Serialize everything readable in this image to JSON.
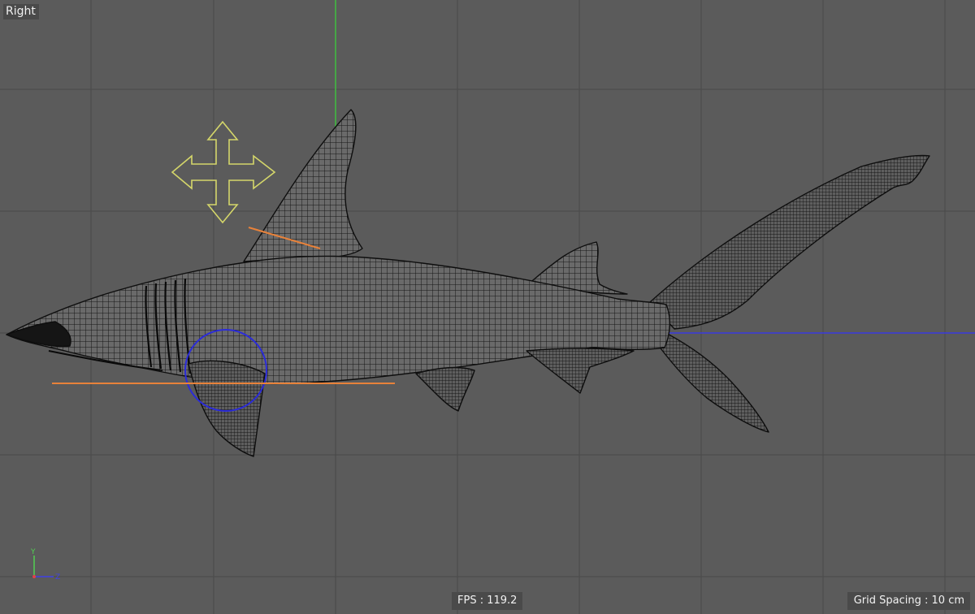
{
  "viewport": {
    "view_name": "Right",
    "fps_label": "FPS : 119.2",
    "grid_spacing_label": "Grid Spacing : 10 cm"
  },
  "axis_gizmo": {
    "y_label": "Y",
    "z_label": "Z",
    "colors": {
      "x": "#e0404a",
      "y": "#52d052",
      "z": "#4040e6"
    }
  },
  "icons": {
    "move_tool": "move-arrows-icon",
    "world_axis": "axis-gizmo-icon"
  },
  "colors": {
    "background": "#5b5b5b",
    "grid_line": "#4b4b4b",
    "mesh_wire": "#111111",
    "move_handle": "#d4d66a",
    "selection_guide": "#e8823a",
    "selection_circle": "#2b2bd8",
    "y_axis": "#3fbf3f",
    "z_axis": "#3b3be0"
  },
  "scene": {
    "object": "shark-mesh"
  }
}
